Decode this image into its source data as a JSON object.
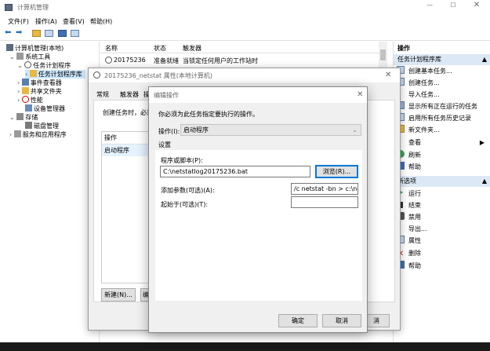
{
  "main_window": {
    "title": "计算机管理",
    "menu": [
      "文件(F)",
      "操作(A)",
      "查看(V)",
      "帮助(H)"
    ]
  },
  "tree": {
    "items": [
      {
        "label": "计算机管理(本地)",
        "level": 0
      },
      {
        "label": "系统工具",
        "level": 1
      },
      {
        "label": "任务计划程序",
        "level": 2
      },
      {
        "label": "任务计划程序库",
        "level": 3
      },
      {
        "label": "事件查看器",
        "level": 2
      },
      {
        "label": "共享文件夹",
        "level": 2
      },
      {
        "label": "性能",
        "level": 2
      },
      {
        "label": "设备管理器",
        "level": 2
      },
      {
        "label": "存储",
        "level": 1
      },
      {
        "label": "磁盘管理",
        "level": 2
      },
      {
        "label": "服务和应用程序",
        "level": 1
      }
    ]
  },
  "task_list": {
    "headers": [
      "名称",
      "状态",
      "触发器"
    ],
    "row": {
      "name": "20175236",
      "status": "准备就绪",
      "trigger": "当锁定任何用户的工作站时"
    }
  },
  "actions": {
    "header": "操作",
    "section1": "任务计划程序库",
    "items1": [
      "创建基本任务...",
      "创建任务...",
      "导入任务...",
      "显示所有正在运行的任务",
      "启用所有任务历史记录",
      "新文件夹...",
      "查看",
      "刷新",
      "帮助"
    ],
    "section2": "所选项",
    "items2": [
      "运行",
      "结束",
      "禁用",
      "导出...",
      "属性",
      "删除",
      "帮助"
    ]
  },
  "props_dialog": {
    "title": "20175236_netstat 属性(本地计算机)",
    "tabs": [
      "常规",
      "触发器",
      "操"
    ],
    "description": "创建任务时，必须",
    "list_header": "操作",
    "list_item": "启动程序",
    "new_button": "新建(N)...",
    "edit_button_partial": "编",
    "cancel_partial": "消"
  },
  "edit_dialog": {
    "title": "编辑操作",
    "prompt": "你必须为此任务指定要执行的操作。",
    "action_label": "操作(I):",
    "action_value": "启动程序",
    "settings_label": "设置",
    "program_label": "程序或脚本(P):",
    "program_value": "C:\\netstatlog20175236.bat",
    "browse_button": "浏览(R)...",
    "args_label": "添加参数(可选)(A):",
    "args_value": "/c netstat -bn > c:\\netst",
    "start_label": "起始于(可选)(T):",
    "start_value": "",
    "ok_button": "确定",
    "cancel_button": "取消"
  },
  "colors": {
    "accent": "#0078d7",
    "selection": "#cce8ff",
    "action_header": "#dce8f5"
  }
}
